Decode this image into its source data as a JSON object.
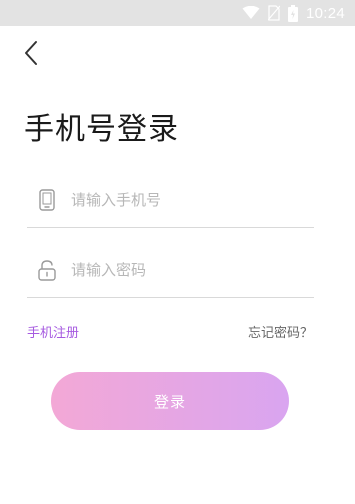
{
  "status_bar": {
    "time": "10:24",
    "icons": [
      "wifi-icon",
      "no-sim-icon",
      "battery-icon"
    ]
  },
  "nav": {
    "back_icon": "chevron-left-icon"
  },
  "page": {
    "title": "手机号登录"
  },
  "form": {
    "phone": {
      "icon": "phone-icon",
      "placeholder": "请输入手机号",
      "value": ""
    },
    "password": {
      "icon": "lock-icon",
      "placeholder": "请输入密码",
      "value": ""
    }
  },
  "links": {
    "register": "手机注册",
    "forgot_password": "忘记密码？"
  },
  "login_button": {
    "label": "登录"
  },
  "colors": {
    "accent_purple": "#a65ae0",
    "button_gradient_start": "#f3a8d6",
    "button_gradient_end": "#d9a5f0",
    "status_bar_bg": "#e3e3e3"
  }
}
